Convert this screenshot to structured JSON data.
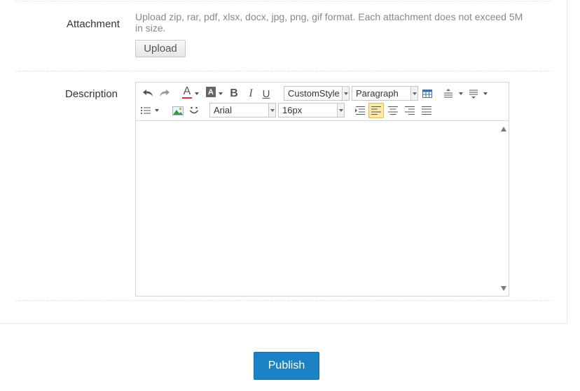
{
  "attachment": {
    "label": "Attachment",
    "hint": "Upload zip, rar, pdf, xlsx, docx, jpg, png, gif format. Each attachment does not exceed 5M in size.",
    "upload_label": "Upload"
  },
  "description": {
    "label": "Description",
    "toolbar": {
      "custom_style": "CustomStyle",
      "paragraph": "Paragraph",
      "font_family": "Arial",
      "font_size": "16px",
      "bold": "B",
      "italic": "I",
      "underline": "U",
      "font_color_glyph": "A",
      "bg_color_glyph": "A"
    },
    "content": ""
  },
  "publish_label": "Publish",
  "colors": {
    "accent": "#1a82c5",
    "active_button": "#fde9a8",
    "image_icon_green": "#3a9a3a"
  }
}
